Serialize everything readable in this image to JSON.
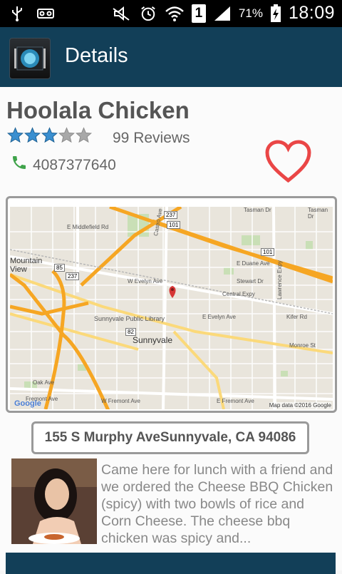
{
  "status_bar": {
    "battery_percent": "71%",
    "time": "18:09",
    "sim_slot": "1",
    "icons": [
      "usb-icon",
      "voicemail-icon",
      "mute-icon",
      "alarm-icon",
      "wifi-icon",
      "signal-icon",
      "battery-charging-icon"
    ]
  },
  "app_bar": {
    "title": "Details",
    "icon": "app-logo-icon"
  },
  "restaurant": {
    "name": "Hoolala Chicken",
    "rating": 3,
    "rating_max": 5,
    "reviews_label": "99 Reviews",
    "phone": "4087377640",
    "phone_icon": "phone-icon",
    "favorite_icon": "heart-icon",
    "address": "155 S Murphy AveSunnyvale, CA 94086"
  },
  "map": {
    "labels": {
      "mountain_view": "Mountain\nView",
      "sunnyvale": "Sunnyvale",
      "library": "Sunnyvale Public Library",
      "tasman_dr": "Tasman Dr",
      "tasman_dr_right": "Tasman Dr",
      "e_middlefield": "E Middlefield Rd",
      "e_evelyn": "W Evelyn Ave",
      "e_evelyn_2": "E Evelyn Ave",
      "central_expy": "Central Expy",
      "e_duane": "E Duane Ave",
      "stewart": "Stewart Dr",
      "kifer": "Kifer Rd",
      "monroe": "Monroe St",
      "w_fremont": "W Fremont Ave",
      "e_fremont": "E Fremont Ave",
      "fremont_ave_left": "Fremont Ave",
      "oak_ave": "Oak Ave",
      "shoreline": "Castro Ave",
      "lawrence": "Lawrence Expy",
      "map_data": "Map data ©2016 Google",
      "google": "Google",
      "hwy_237": "237",
      "hwy_101": "101",
      "hwy_85": "85",
      "hwy_82": "82",
      "hwy_237b": "237",
      "hwy_101b": "101"
    }
  },
  "review": {
    "text": "Came here for lunch with a friend and we ordered the Cheese BBQ Chicken (spicy) with two bowls of rice and Corn Cheese. The cheese bbq chicken was spicy and..."
  },
  "colors": {
    "app_bar": "#123f58",
    "star_filled": "#3a8fd0",
    "star_empty": "#a8a8a8",
    "heart": "#ea4646",
    "phone": "#3fa34a",
    "highway": "#f6a623"
  }
}
